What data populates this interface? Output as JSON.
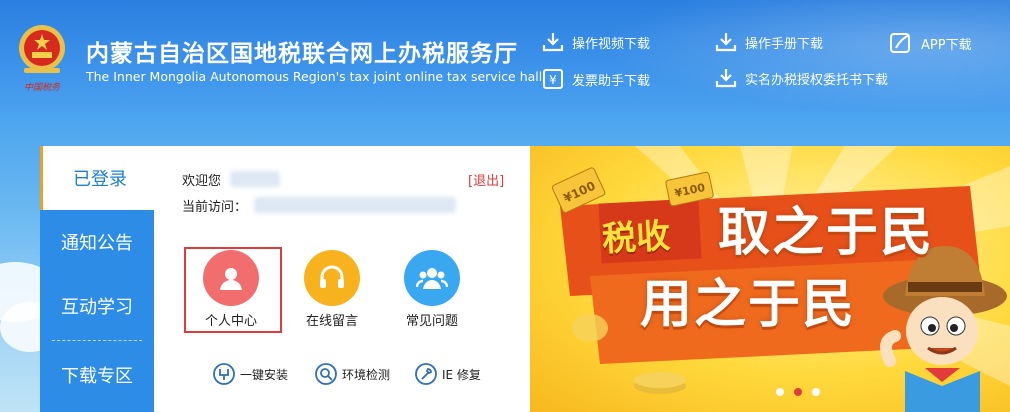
{
  "header": {
    "title": "内蒙古自治区国地税联合网上办税服务厅",
    "subtitle": "The Inner Mongolia Autonomous Region's tax joint online tax service hall",
    "emblem_caption": "中国税务",
    "downloads": [
      {
        "label": "操作视频下载",
        "icon": "download-icon"
      },
      {
        "label": "操作手册下载",
        "icon": "download-icon"
      },
      {
        "label": "APP下载",
        "icon": "app-icon"
      },
      {
        "label": "发票助手下载",
        "icon": "invoice-icon"
      },
      {
        "label": "实名办税授权委托书下载",
        "icon": "download-icon"
      }
    ]
  },
  "sidebar": {
    "items": [
      {
        "label": "已登录",
        "active": true
      },
      {
        "label": "通知公告"
      },
      {
        "label": "互动学习"
      },
      {
        "label": "下载专区"
      }
    ]
  },
  "user": {
    "welcome_label": "欢迎您",
    "visit_label": "当前访问：",
    "logout_label": "[退出]"
  },
  "quick_actions": [
    {
      "label": "个人中心",
      "icon": "person-icon",
      "color": "#f26d6d",
      "selected": true
    },
    {
      "label": "在线留言",
      "icon": "headset-icon",
      "color": "#f7b21e"
    },
    {
      "label": "常见问题",
      "icon": "group-icon",
      "color": "#3aa8f0"
    }
  ],
  "tools": [
    {
      "label": "一键安装",
      "icon": "install-icon"
    },
    {
      "label": "环境检测",
      "icon": "search-icon"
    },
    {
      "label": "IE 修复",
      "icon": "wrench-icon"
    }
  ],
  "banner": {
    "badge": "税收",
    "line1": "取之于民",
    "line2": "用之于民",
    "coin1": "¥100",
    "coin2": "¥100",
    "dots": 3,
    "active_dot": 2
  },
  "colors": {
    "brand_blue": "#2d8de6",
    "accent_red": "#e23b3b",
    "accent_orange": "#f0a020"
  }
}
